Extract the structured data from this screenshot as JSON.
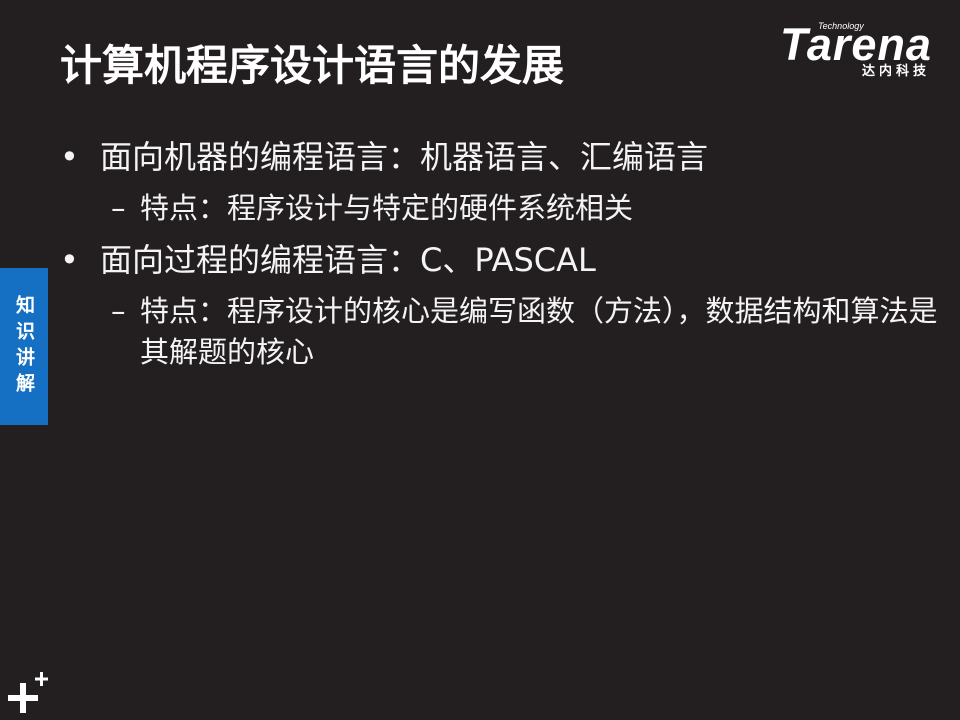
{
  "colors": {
    "background": "#231f20",
    "text": "#ffffff",
    "side_tab": "#1570c4"
  },
  "logo": {
    "tagline": "Technology",
    "brand": "Tarena",
    "cn_name": "达内科技"
  },
  "icons": {
    "footer_mark": "plus-plus-icon"
  },
  "slide": {
    "title": "计算机程序设计语言的发展",
    "side_tab_label": "知识讲解",
    "bullet_marker": "•",
    "sub_marker": "–",
    "bullets": [
      {
        "text": "面向机器的编程语言：机器语言、汇编语言",
        "sub": [
          {
            "text": "特点：程序设计与特定的硬件系统相关"
          }
        ]
      },
      {
        "text": "面向过程的编程语言：C、PASCAL",
        "sub": [
          {
            "text": "特点：程序设计的核心是编写函数（方法），数据结构和算法是其解题的核心"
          }
        ]
      }
    ]
  }
}
